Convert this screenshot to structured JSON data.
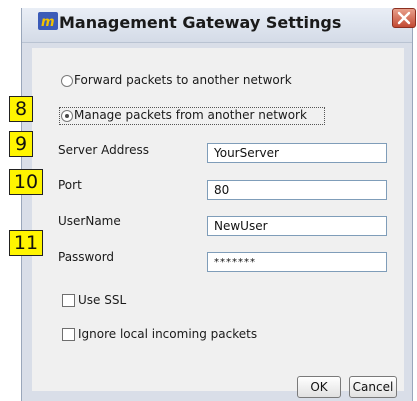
{
  "window": {
    "title": "Management Gateway Settings"
  },
  "options": {
    "forward_label": "Forward packets to another network",
    "manage_label": "Manage packets from another network",
    "selected": "manage"
  },
  "fields": {
    "server_address_label": "Server Address",
    "server_address_value": "YourServer",
    "port_label": "Port",
    "port_value": "80",
    "username_label": "UserName",
    "username_value": "NewUser",
    "password_label": "Password",
    "password_value": "*******"
  },
  "checkboxes": {
    "use_ssl_label": "Use SSL",
    "ignore_label": "Ignore local incoming packets"
  },
  "buttons": {
    "ok_label": "OK",
    "cancel_label": "Cancel"
  },
  "callouts": [
    "8",
    "9",
    "10",
    "11"
  ],
  "colors": {
    "callout_bg": "#fff500",
    "title_bg": "#dfe5ef",
    "close_button": "#c24a34"
  }
}
